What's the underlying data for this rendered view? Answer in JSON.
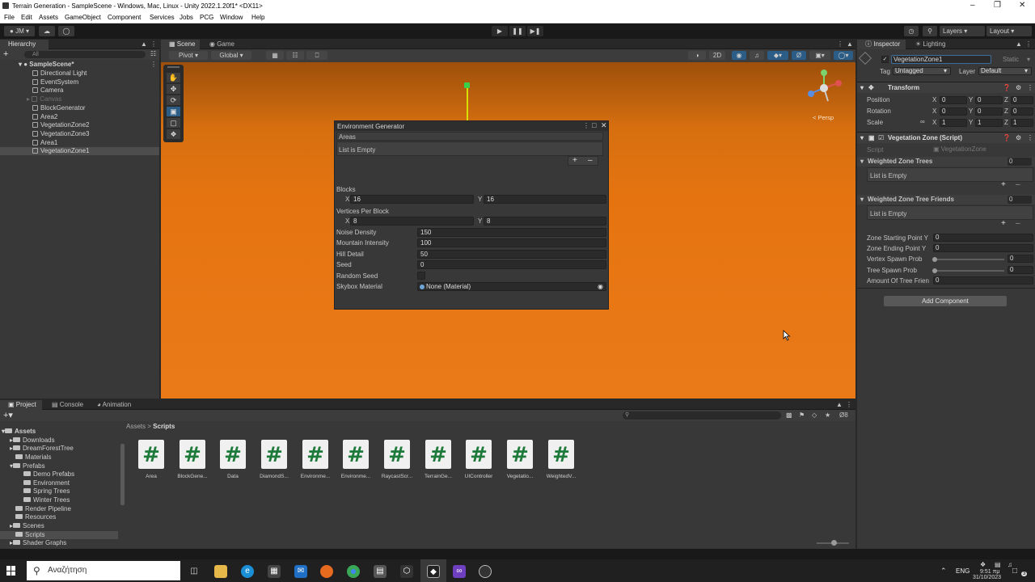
{
  "window": {
    "title": "Terrain Generation - SampleScene - Windows, Mac, Linux - Unity 2022.1.20f1* <DX11>"
  },
  "menu": [
    "File",
    "Edit",
    "Assets",
    "GameObject",
    "Component",
    "Services",
    "Jobs",
    "PCG",
    "Window",
    "Help"
  ],
  "toolbar": {
    "account": "JM",
    "layers": "Layers",
    "layout": "Layout"
  },
  "hierarchy": {
    "tab": "Hierarchy",
    "search_placeholder": "All",
    "scene": "SampleScene*",
    "items": [
      "Directional Light",
      "EventSystem",
      "Camera",
      "Canvas",
      "BlockGenerator",
      "Area2",
      "VegetationZone2",
      "VegetationZone3",
      "Area1",
      "VegetationZone1"
    ]
  },
  "scene": {
    "tabs": [
      "Scene",
      "Game"
    ],
    "pivot": "Pivot",
    "global": "Global",
    "mode2d": "2D",
    "persp": "< Persp"
  },
  "env": {
    "title": "Environment Generator",
    "areas_label": "Areas",
    "areas_empty": "List is Empty",
    "blocks_label": "Blocks",
    "blocks_x": "16",
    "blocks_y": "16",
    "vpb_label": "Vertices Per Block",
    "vpb_x": "8",
    "vpb_y": "8",
    "x": "X",
    "y": "Y",
    "fields": [
      {
        "label": "Noise Density",
        "value": "150"
      },
      {
        "label": "Mountain Intensity",
        "value": "100"
      },
      {
        "label": "Hill Detail",
        "value": "50"
      },
      {
        "label": "Seed",
        "value": "0"
      }
    ],
    "random_seed": "Random Seed",
    "skybox_label": "Skybox Material",
    "skybox_value": "None (Material)"
  },
  "inspector": {
    "tabs": [
      "Inspector",
      "Lighting"
    ],
    "object_name": "VegetationZone1",
    "static": "Static",
    "tag_label": "Tag",
    "tag": "Untagged",
    "layer_label": "Layer",
    "layer": "Default",
    "transform": "Transform",
    "position": "Position",
    "rotation": "Rotation",
    "scale": "Scale",
    "pos": [
      "0",
      "0",
      "0"
    ],
    "rot": [
      "0",
      "0",
      "0"
    ],
    "scl": [
      "1",
      "1",
      "1"
    ],
    "xyz": [
      "X",
      "Y",
      "Z"
    ],
    "script_comp": "Vegetation Zone (Script)",
    "script_label": "Script",
    "script_value": "VegetationZone",
    "wzt": "Weighted Zone Trees",
    "wzt_count": "0",
    "wzt_empty": "List is Empty",
    "wztf": "Weighted Zone Tree Friends",
    "wztf_count": "0",
    "wztf_empty": "List is Empty",
    "props": [
      {
        "label": "Zone Starting Point Y",
        "value": "0"
      },
      {
        "label": "Zone Ending Point Y",
        "value": "0"
      },
      {
        "label": "Vertex Spawn Prob",
        "value": "0"
      },
      {
        "label": "Tree Spawn Prob",
        "value": "0"
      },
      {
        "label": "Amount Of Tree Frien",
        "value": "0"
      }
    ],
    "add_component": "Add Component"
  },
  "project": {
    "tabs": [
      "Project",
      "Console",
      "Animation"
    ],
    "breadcrumb_root": "Assets",
    "breadcrumb_sep": ">",
    "breadcrumb_leaf": "Scripts",
    "hidden_count": "8",
    "tree": [
      {
        "label": "Assets",
        "indent": 0
      },
      {
        "label": "Downloads",
        "indent": 1
      },
      {
        "label": "DreamForestTree",
        "indent": 1
      },
      {
        "label": "Materials",
        "indent": 1
      },
      {
        "label": "Prefabs",
        "indent": 1
      },
      {
        "label": "Demo Prefabs",
        "indent": 2
      },
      {
        "label": "Environment",
        "indent": 2
      },
      {
        "label": "Spring Trees",
        "indent": 2
      },
      {
        "label": "Winter Trees",
        "indent": 2
      },
      {
        "label": "Render Pipeline",
        "indent": 1
      },
      {
        "label": "Resources",
        "indent": 1
      },
      {
        "label": "Scenes",
        "indent": 1
      },
      {
        "label": "Scripts",
        "indent": 1
      },
      {
        "label": "Shader Graphs",
        "indent": 1
      }
    ],
    "assets": [
      "Area",
      "BlockGene...",
      "Data",
      "DiamondS...",
      "Environme...",
      "Environme...",
      "RaycastScr...",
      "TerrainGe...",
      "UIController",
      "Vegetatio...",
      "WeightedV..."
    ]
  },
  "taskbar": {
    "search": "Αναζήτηση",
    "lang": "ENG",
    "time": "9:51 πμ",
    "date": "31/10/2023",
    "notif": "3"
  },
  "colors": {
    "accent": "#2c5d87",
    "scene_orange": "#e57410",
    "asset_hash": "#1e7a3a"
  }
}
